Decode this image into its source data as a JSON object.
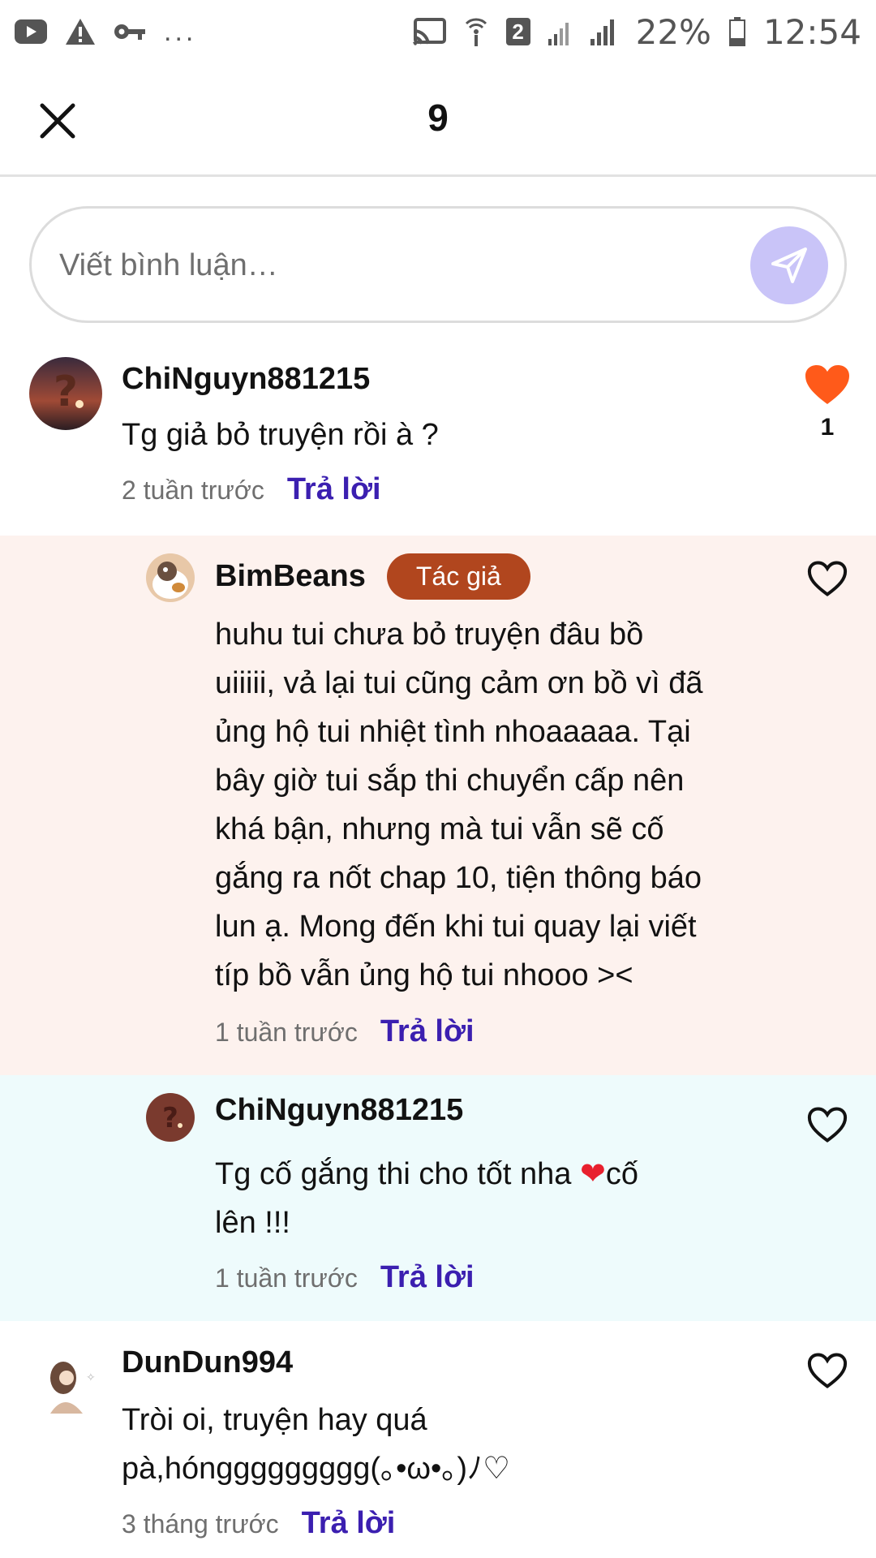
{
  "status_bar": {
    "left_icons": [
      "youtube-icon",
      "warning-icon",
      "key-icon"
    ],
    "more": "...",
    "sim_badge": "2",
    "battery": "22%",
    "time": "12:54"
  },
  "header": {
    "title": "9",
    "close_icon": "close-icon"
  },
  "composer": {
    "placeholder": "Viết bình luận…",
    "send_icon": "send-icon",
    "send_color": "#c9c4f8"
  },
  "colors": {
    "accent_link": "#3b1fb0",
    "author_badge": "#b1461e",
    "liked_heart": "#ff5a1a",
    "reply_bg_author": "#fdf2ee",
    "reply_bg_user": "#eefbfc"
  },
  "comments": [
    {
      "username": "ChiNguyn881215",
      "text": "Tg giả bỏ truyện rồi à ?",
      "time": "2 tuần trước",
      "reply_label": "Trả lời",
      "likes": "1",
      "liked": true
    },
    {
      "username": "BimBeans",
      "badge": "Tác giả",
      "text_lines": [
        "huhu tui chưa bỏ truyện đâu bồ",
        "uiiiii, vả lại tui cũng cảm ơn bồ vì đã",
        "ủng hộ tui nhiệt tình nhoaaaaa. Tại",
        "bây giờ tui sắp thi chuyển cấp nên",
        "khá bận, nhưng mà tui vẫn sẽ cố",
        "gắng ra nốt chap 10, tiện thông báo",
        "lun ạ. Mong đến khi tui quay lại viết",
        "típ bồ vẫn ủng hộ tui nhooo ><"
      ],
      "time": "1 tuần trước",
      "reply_label": "Trả lời",
      "liked": false
    },
    {
      "username": "ChiNguyn881215",
      "text_line1_a": "Tg cố gắng thi cho tốt nha ",
      "text_emoji": "❤",
      "text_line1_b": "cố",
      "text_line2": "lên !!!",
      "time": "1 tuần trước",
      "reply_label": "Trả lời",
      "liked": false
    },
    {
      "username": "DunDun994",
      "text_lines": [
        "Tròi oi, truyện hay quá",
        "pà,hónggggggggg(｡•ω•｡)ﾉ♡"
      ],
      "time": "3 tháng trước",
      "reply_label": "Trả lời",
      "liked": false
    }
  ]
}
